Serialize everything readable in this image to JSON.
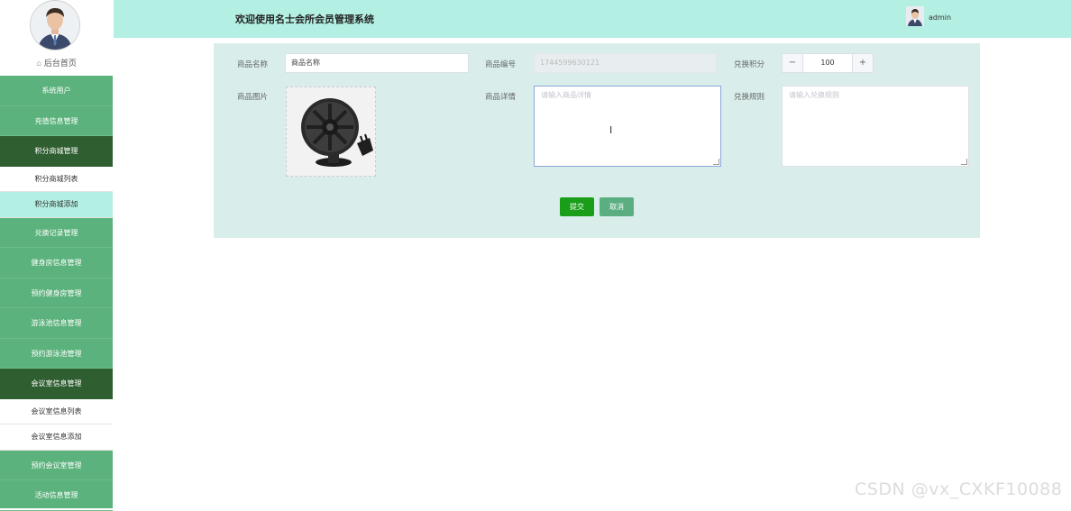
{
  "sidebar": {
    "home_label": "后台首页",
    "items": [
      {
        "label": "系统用户",
        "type": "menu"
      },
      {
        "label": "充值信息管理",
        "type": "menu"
      },
      {
        "label": "积分商城管理",
        "type": "menu-active"
      },
      {
        "label": "积分商城列表",
        "type": "sub"
      },
      {
        "label": "积分商城添加",
        "type": "sub-selected"
      },
      {
        "label": "兑换记录管理",
        "type": "menu"
      },
      {
        "label": "健身房信息管理",
        "type": "menu"
      },
      {
        "label": "预约健身房管理",
        "type": "menu"
      },
      {
        "label": "游泳池信息管理",
        "type": "menu"
      },
      {
        "label": "预约游泳池管理",
        "type": "menu"
      },
      {
        "label": "会议室信息管理",
        "type": "menu-active"
      },
      {
        "label": "会议室信息列表",
        "type": "sub"
      },
      {
        "label": "会议室信息添加",
        "type": "sub"
      },
      {
        "label": "预约会议室管理",
        "type": "menu"
      },
      {
        "label": "活动信息管理",
        "type": "menu"
      }
    ]
  },
  "header": {
    "title": "欢迎使用名士会所会员管理系统",
    "username": "admin",
    "bg_color": "#b3efe2"
  },
  "form": {
    "name_label": "商品名称",
    "name_value": "商品名称",
    "code_label": "商品编号",
    "code_value": "1744599630121",
    "points_label": "兑换积分",
    "points_value": "100",
    "minus": "−",
    "plus": "+",
    "image_label": "商品图片",
    "detail_label": "商品详情",
    "detail_placeholder": "请输入商品详情",
    "rules_label": "兑换规则",
    "rules_placeholder": "请输入兑换规则",
    "submit_label": "提交",
    "cancel_label": "取消"
  },
  "watermark": "CSDN @vx_CXKF10088",
  "colors": {
    "sidebar": "#5cb27c",
    "sidebar_active": "#2f5e30",
    "panel": "#d9eeeb",
    "submit": "#1a9e1a",
    "cancel": "#5aae80"
  }
}
